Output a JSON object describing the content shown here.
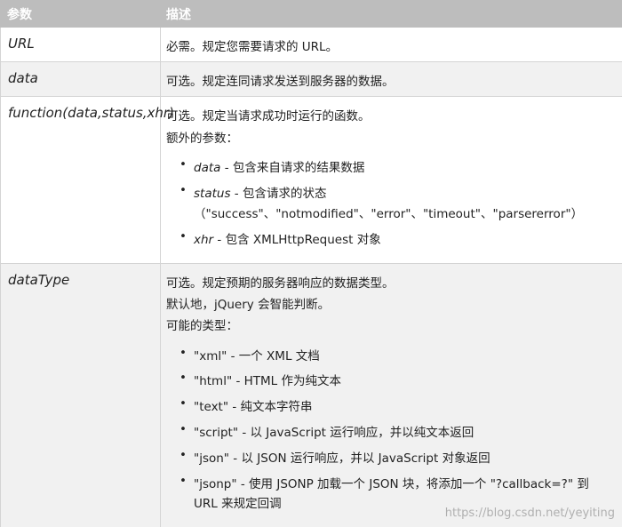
{
  "header": {
    "col1": "参数",
    "col2": "描述"
  },
  "rows": {
    "url": {
      "name": "URL",
      "desc": "必需。规定您需要请求的 URL。"
    },
    "data": {
      "name": "data",
      "desc": "可选。规定连同请求发送到服务器的数据。"
    },
    "func": {
      "name": "function(data,status,xhr)",
      "desc": "可选。规定当请求成功时运行的函数。",
      "extra": "额外的参数：",
      "items": [
        {
          "key": "data",
          "text": " - 包含来自请求的结果数据"
        },
        {
          "key": "status",
          "text": " - 包含请求的状态",
          "cont": "（\"success\"、\"notmodified\"、\"error\"、\"timeout\"、\"parsererror\"）"
        },
        {
          "key": "xhr",
          "text": " - 包含 XMLHttpRequest 对象"
        }
      ]
    },
    "datatype": {
      "name": "dataType",
      "desc": "可选。规定预期的服务器响应的数据类型。",
      "line2": "默认地，jQuery 会智能判断。",
      "line3": "可能的类型：",
      "items": [
        "\"xml\" - 一个 XML 文档",
        "\"html\" - HTML 作为纯文本",
        "\"text\" - 纯文本字符串",
        "\"script\" - 以 JavaScript 运行响应，并以纯文本返回",
        "\"json\" - 以 JSON 运行响应，并以 JavaScript 对象返回",
        "\"jsonp\" - 使用 JSONP 加载一个 JSON 块，将添加一个 \"?callback=?\" 到"
      ],
      "item6_cont": "URL 来规定回调"
    }
  },
  "watermark": "https://blog.csdn.net/yeyiting",
  "colors": {
    "header_bg": "#bdbdbd",
    "row_alt": "#f1f1f1",
    "border": "#d4d4d4"
  }
}
